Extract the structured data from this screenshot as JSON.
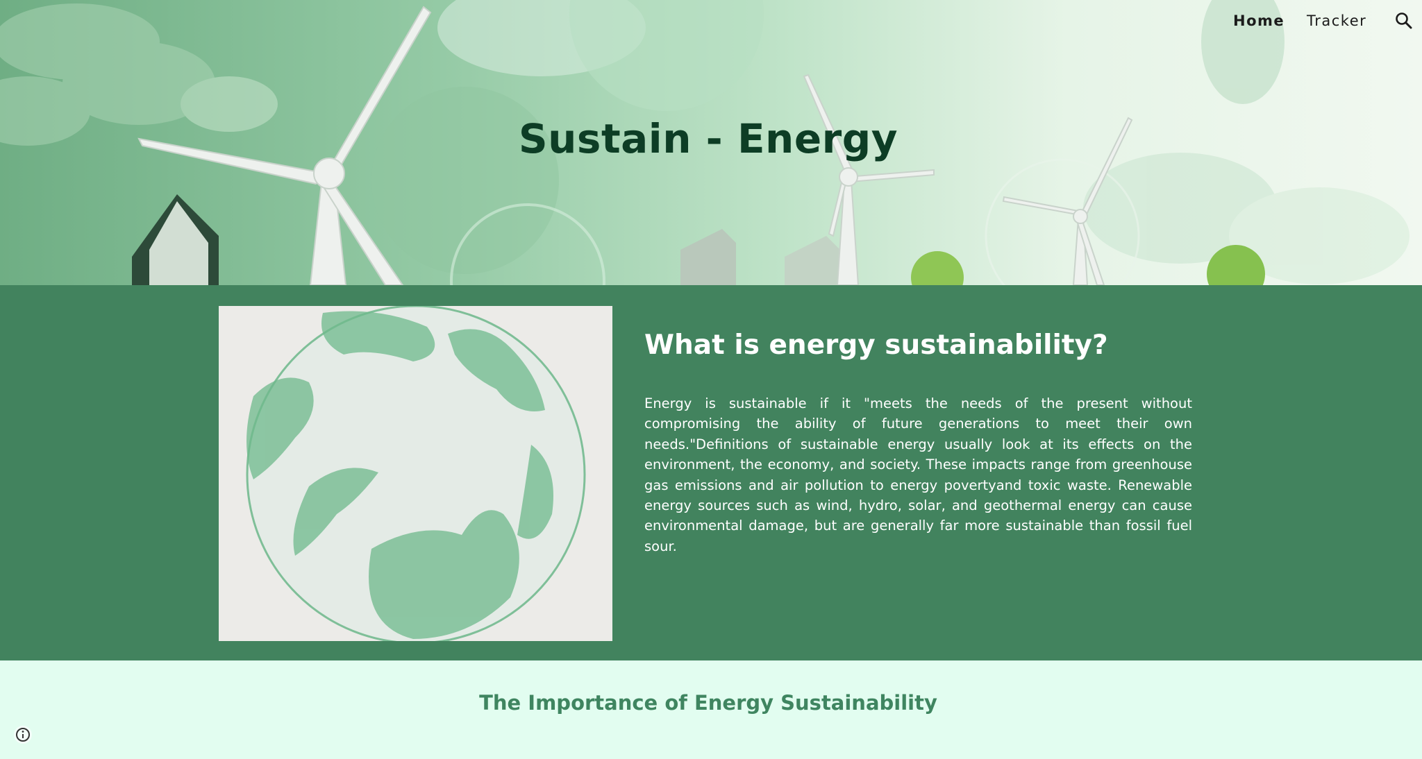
{
  "header": {
    "nav": [
      {
        "label": "Home",
        "active": true
      },
      {
        "label": "Tracker",
        "active": false
      }
    ],
    "search_icon": "search-icon",
    "title": "Sustain - Energy"
  },
  "intro": {
    "heading": "What is energy sustainability?",
    "body": "Energy is sustainable if it \"meets the needs of the present without compromising the ability of future generations to meet their own needs.\"Definitions of sustainable energy usually look at its effects on the environment, the economy, and society. These impacts range from greenhouse gas emissions and air pollution to energy povertyand toxic waste. Renewable energy sources such as wind, hydro, solar, and geothermal energy can cause environmental damage, but are generally far more sustainable than fossil fuel sour.",
    "image_icon": "watercolor-globe-image"
  },
  "importance": {
    "heading": "The Importance of Energy Sustainability"
  },
  "footer": {
    "info_icon": "info-icon"
  },
  "colors": {
    "hero_title": "#0d3d25",
    "intro_background": "#42835e",
    "importance_background": "#e2fdf0",
    "importance_heading": "#3f8560"
  }
}
